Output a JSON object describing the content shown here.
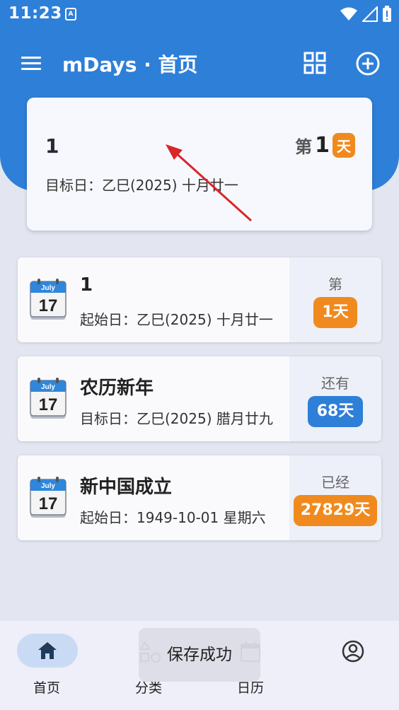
{
  "status_bar": {
    "time": "11:23",
    "notif_letter": "A"
  },
  "app_bar": {
    "title": "mDays · 首页"
  },
  "hero": {
    "name": "1",
    "target_date": "目标日：乙巳(2025) 十月廿一",
    "prefix": "第",
    "count": "1",
    "unit": "天"
  },
  "events": [
    {
      "icon_month": "July",
      "icon_day": "17",
      "title": "1",
      "subtitle": "起始日：乙巳(2025) 十月廿一",
      "label": "第",
      "badge": "1天",
      "color": "#F08A1E"
    },
    {
      "icon_month": "July",
      "icon_day": "17",
      "title": "农历新年",
      "subtitle": "目标日：乙巳(2025) 腊月廿九",
      "label": "还有",
      "badge": "68天",
      "color": "#2E7FD8"
    },
    {
      "icon_month": "July",
      "icon_day": "17",
      "title": "新中国成立",
      "subtitle": "起始日：1949-10-01 星期六",
      "label": "已经",
      "badge": "27829天",
      "color": "#F08A1E"
    }
  ],
  "bottom_nav": {
    "items": [
      {
        "label": "首页",
        "icon": "home-icon",
        "active": true
      },
      {
        "label": "分类",
        "icon": "category-icon",
        "active": false
      },
      {
        "label": "日历",
        "icon": "calendar-icon",
        "active": false
      },
      {
        "label": "",
        "icon": "profile-icon",
        "active": false
      }
    ]
  },
  "toast": {
    "message": "保存成功"
  },
  "colors": {
    "primary": "#2E7FD8",
    "accent": "#F08A1E",
    "background": "#E3E6F0"
  }
}
